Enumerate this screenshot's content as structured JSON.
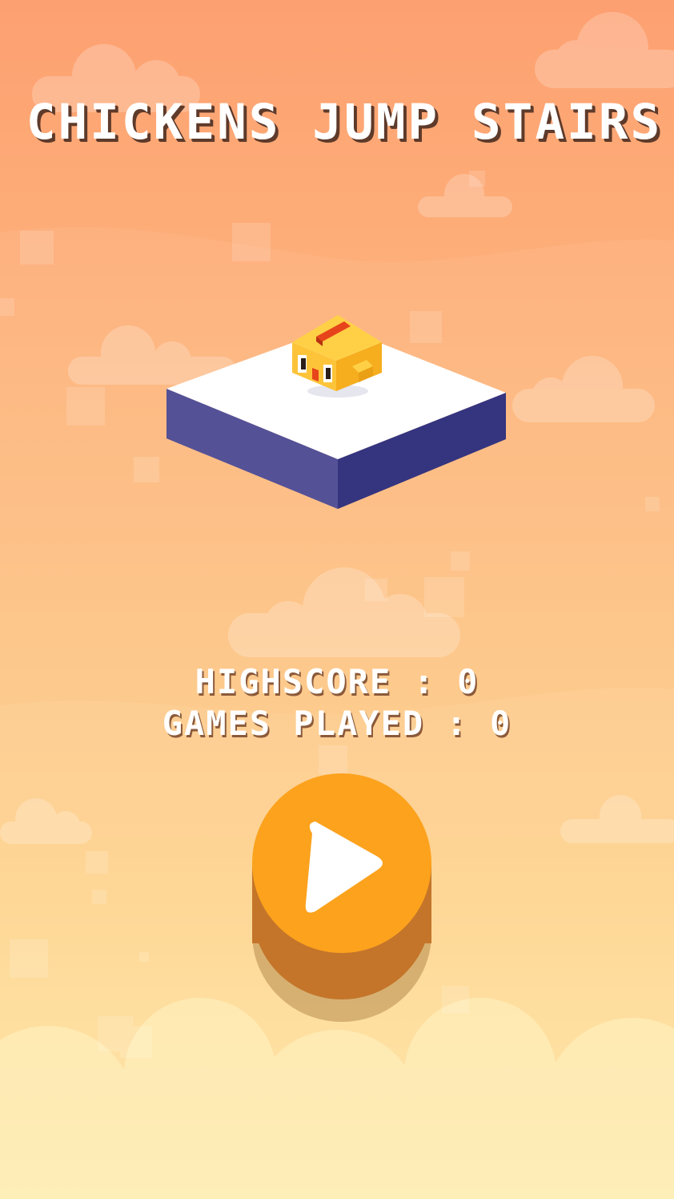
{
  "game": {
    "title": "CHICKENS JUMP STAIRS"
  },
  "stats": {
    "highscore_label": "HIGHSCORE",
    "highscore_value": "0",
    "games_played_label": "GAMES PLAYED",
    "games_played_value": "0",
    "separator": " : "
  },
  "play_button": {
    "icon": "play-icon"
  },
  "colors": {
    "sky_top": "#fda071",
    "sky_bottom": "#fee6a2",
    "platform_top": "#ffffff",
    "platform_left": "#545197",
    "platform_right": "#35347f",
    "chicken_body": "#fbbf2f",
    "chicken_crest": "#e7441b",
    "play_button_top": "#fca21d",
    "play_button_side": "#c4752a"
  }
}
